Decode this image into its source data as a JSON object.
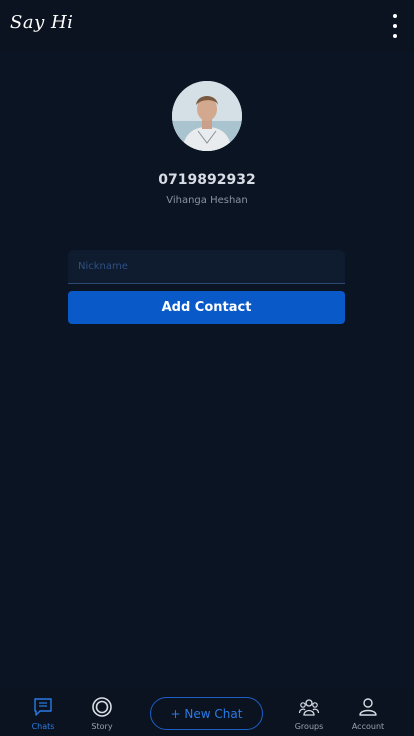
{
  "app": {
    "title": "Say Hi"
  },
  "contact": {
    "phone": "0719892932",
    "name": "Vihanga Heshan"
  },
  "form": {
    "nickname_placeholder": "Nickname",
    "nickname_value": "",
    "add_button_label": "Add Contact"
  },
  "nav": {
    "chats": "Chats",
    "story": "Story",
    "new_chat": "+ New Chat",
    "groups": "Groups",
    "account": "Account",
    "active": "chats"
  },
  "colors": {
    "background": "#0b1422",
    "accent": "#0a59c9",
    "accent_text": "#2a7be4"
  },
  "icons": {
    "menu": "more-vertical-icon",
    "chats": "chat-bubble-icon",
    "story": "story-circle-icon",
    "groups": "users-icon",
    "account": "user-icon"
  }
}
